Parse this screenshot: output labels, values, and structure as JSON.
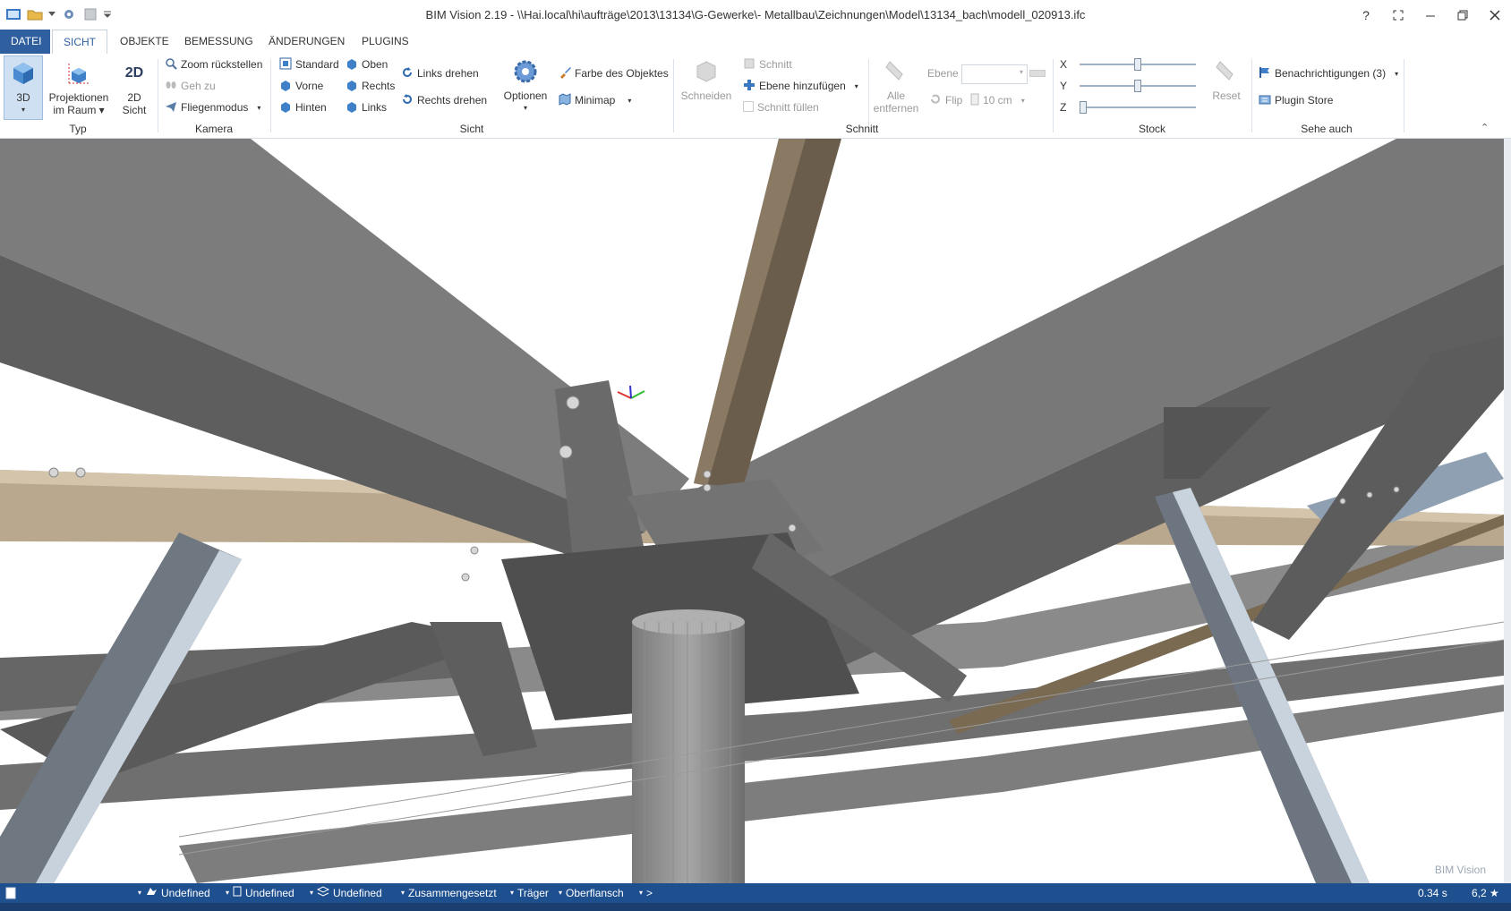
{
  "window": {
    "title": "BIM Vision 2.19 - \\\\Hai.local\\hi\\aufträge\\2013\\13134\\G-Gewerke\\- Metallbau\\Zeichnungen\\Model\\13134_bach\\modell_020913.ifc",
    "help_label": "?"
  },
  "tabs": [
    {
      "label": "DATEI"
    },
    {
      "label": "SICHT"
    },
    {
      "label": "OBJEKTE"
    },
    {
      "label": "BEMESSUNG"
    },
    {
      "label": "ÄNDERUNGEN"
    },
    {
      "label": "PLUGINS"
    }
  ],
  "ribbon": {
    "typ": {
      "label": "Typ",
      "btn_3d": "3D",
      "btn_projektionen_1": "Projektionen",
      "btn_projektionen_2": "im Raum",
      "btn_2d_1": "2D",
      "btn_2d_2": "Sicht",
      "icon_2d_text": "2D"
    },
    "kamera": {
      "label": "Kamera",
      "zoom_reset": "Zoom rückstellen",
      "geh_zu": "Geh zu",
      "fliegenmodus": "Fliegenmodus"
    },
    "sicht": {
      "label": "Sicht",
      "standard": "Standard",
      "vorne": "Vorne",
      "hinten": "Hinten",
      "oben": "Oben",
      "rechts": "Rechts",
      "links": "Links",
      "links_drehen": "Links drehen",
      "rechts_drehen": "Rechts drehen",
      "optionen": "Optionen",
      "farbe": "Farbe des Objektes",
      "minimap": "Minimap"
    },
    "schnitt": {
      "label": "Schnitt",
      "schneiden": "Schneiden",
      "schnitt": "Schnitt",
      "ebene_hinzu": "Ebene hinzufügen",
      "schnitt_fuellen": "Schnitt füllen",
      "alle_1": "Alle",
      "alle_2": "entfernen",
      "ebene": "Ebene",
      "flip": "Flip",
      "cm": "10 cm"
    },
    "stock": {
      "label": "Stock",
      "x": "X",
      "y": "Y",
      "z": "Z",
      "x_value": 0.5,
      "y_value": 0.5,
      "z_value": 0.0,
      "reset": "Reset"
    },
    "seheauch": {
      "label": "Sehe auch",
      "benachrichtigungen": "Benachrichtigungen (3)",
      "plugin_store": "Plugin Store"
    }
  },
  "viewport": {
    "watermark": "BIM Vision"
  },
  "statusbar": {
    "items": [
      "Undefined",
      "Undefined",
      "Undefined",
      "Zusammengesetzt",
      "Träger",
      "Oberflansch",
      ">"
    ],
    "time": "0.34 s",
    "rating": "6,2 ★"
  }
}
